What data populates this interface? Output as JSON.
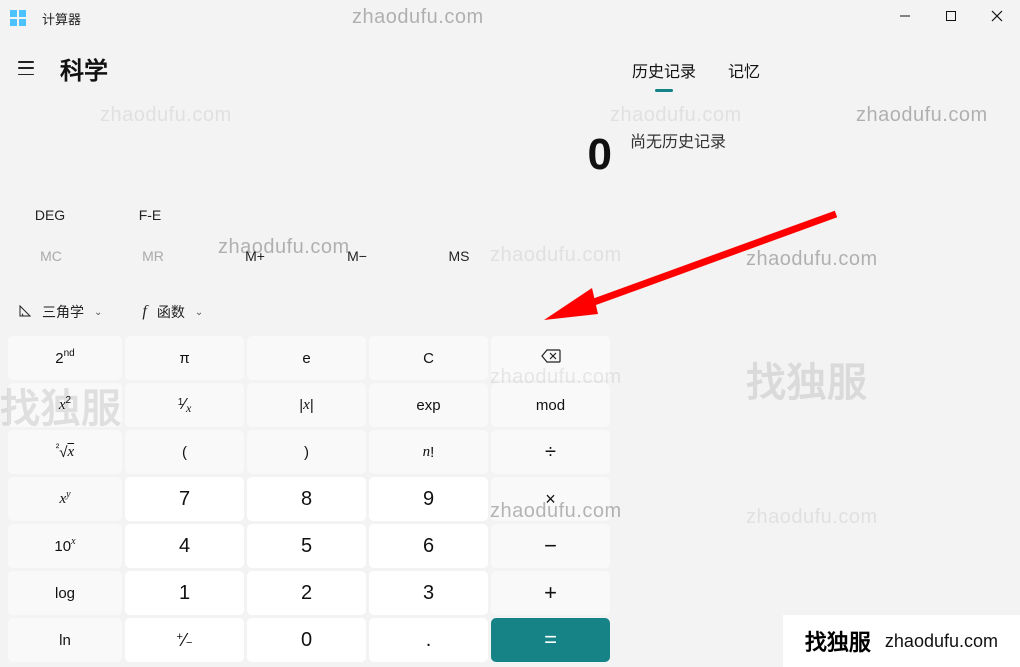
{
  "window": {
    "title": "计算器",
    "minimize": "−",
    "maximize": "☐",
    "close": "✕"
  },
  "header": {
    "mode": "科学"
  },
  "display": {
    "expression": "",
    "value": "0"
  },
  "angle_row": {
    "deg": "DEG",
    "fe": "F-E"
  },
  "memory_row": {
    "mc": "MC",
    "mr": "MR",
    "mplus": "M+",
    "mminus": "M−",
    "ms": "MS"
  },
  "dropdowns": {
    "trig": "三角学",
    "func": "函数"
  },
  "keys": {
    "r0": {
      "second": "2",
      "second_sup": "nd",
      "pi": "π",
      "e": "e",
      "clear": "C",
      "back": "⌫"
    },
    "r1": {
      "square_base": "x",
      "square_sup": "2",
      "reciprocal": "¹⁄ₓ",
      "abs": "|x|",
      "exp": "exp",
      "mod": "mod"
    },
    "r2": {
      "root_pre": "²",
      "root": "√x",
      "lparen": "(",
      "rparen": ")",
      "fact_base": "n",
      "fact_suffix": "!",
      "div": "÷"
    },
    "r3": {
      "pow_base": "x",
      "pow_sup": "y",
      "d7": "7",
      "d8": "8",
      "d9": "9",
      "mul": "×"
    },
    "r4": {
      "ten_base": "10",
      "ten_sup": "x",
      "d4": "4",
      "d5": "5",
      "d6": "6",
      "sub": "−"
    },
    "r5": {
      "log": "log",
      "d1": "1",
      "d2": "2",
      "d3": "3",
      "add": "+"
    },
    "r6": {
      "ln": "ln",
      "neg_top": "+",
      "neg_bot": "−",
      "d0": "0",
      "dot": ".",
      "eq": "="
    }
  },
  "right_panel": {
    "tabs": {
      "history": "历史记录",
      "memory": "记忆"
    },
    "empty": "尚无历史记录"
  },
  "watermarks": {
    "wm": "zhaodufu.com",
    "brand_cn": "找独服"
  }
}
